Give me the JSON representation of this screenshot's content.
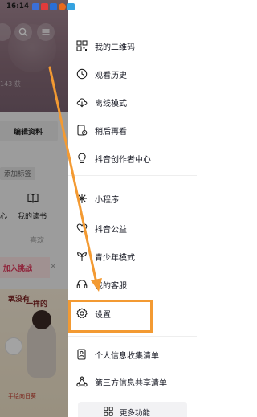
{
  "status_bar": {
    "time": "16:14"
  },
  "profile": {
    "count_text": "143 获",
    "edit_profile": "编辑资料",
    "add_tag": "添加标签",
    "tab_partial": "心",
    "tab_books": "我的读书",
    "likes_tab": "喜欢",
    "join_challenge": "加入挑战",
    "close": "×",
    "thumbnail_text_1": "氧没有",
    "thumbnail_text_2": "一样的",
    "thumbnail_caption": "手绘向日葵"
  },
  "menu": {
    "group1": [
      {
        "label": "我的二维码",
        "icon": "qr-code-icon"
      },
      {
        "label": "观看历史",
        "icon": "history-clock-icon"
      },
      {
        "label": "离线模式",
        "icon": "cloud-download-icon"
      },
      {
        "label": "稍后再看",
        "icon": "watch-later-icon"
      },
      {
        "label": "抖音创作者中心",
        "icon": "lightbulb-icon"
      }
    ],
    "group2": [
      {
        "label": "小程序",
        "icon": "mini-program-icon"
      },
      {
        "label": "抖音公益",
        "icon": "charity-heart-icon"
      },
      {
        "label": "青少年模式",
        "icon": "sprout-icon"
      },
      {
        "label": "我的客服",
        "icon": "headset-icon"
      },
      {
        "label": "设置",
        "icon": "settings-gear-icon"
      }
    ],
    "group3": [
      {
        "label": "个人信息收集清单",
        "icon": "personal-info-icon"
      },
      {
        "label": "第三方信息共享清单",
        "icon": "third-party-share-icon"
      }
    ],
    "more_functions": "更多功能"
  },
  "annotation": {
    "highlight_color": "#f39a32",
    "highlight_target": "设置"
  }
}
